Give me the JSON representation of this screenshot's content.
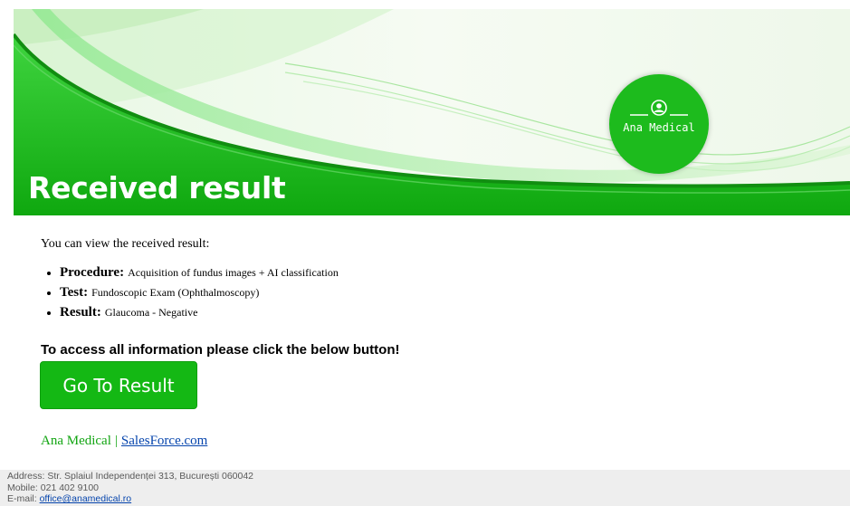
{
  "banner": {
    "title": "Received result",
    "logo_text": "Ana Medical",
    "logo_icon": "user-circle-icon"
  },
  "content": {
    "intro": "You can view the received result:",
    "details": [
      {
        "key": "Procedure:",
        "value": "Acquisition of fundus images + AI classification"
      },
      {
        "key": "Test:",
        "value": "Fundoscopic Exam (Ophthalmoscopy)"
      },
      {
        "key": "Result:",
        "value": "Glaucoma - Negative"
      }
    ],
    "cta_text": "To access all information please click the below button!",
    "button_label": "Go To Result"
  },
  "signature": {
    "company": "Ana Medical",
    "separator": "|",
    "link_text": "SalesForce.com"
  },
  "footer": {
    "address": "Address: Str. Splaiul Independenței 313, București 060042",
    "mobile": "Mobile: 021 402 9100",
    "email_label": "E-mail: ",
    "email": "office@anamedical.ro"
  },
  "colors": {
    "brand_green": "#14b814",
    "link_blue": "#0645ad",
    "footer_bg": "#eeeeee"
  }
}
